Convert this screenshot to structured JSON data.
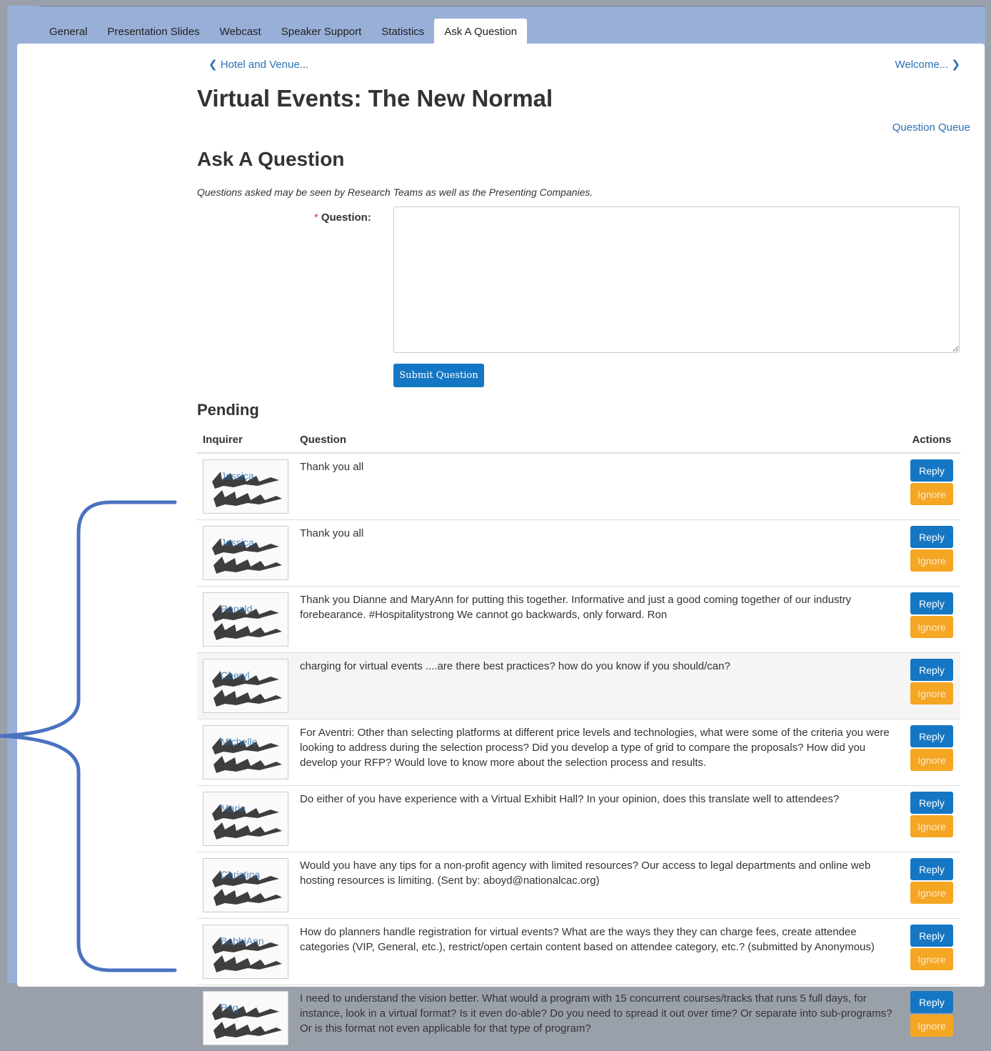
{
  "tabs": [
    "General",
    "Presentation Slides",
    "Webcast",
    "Speaker Support",
    "Statistics",
    "Ask A Question"
  ],
  "pager": {
    "prev": "Hotel and Venue...",
    "next": "Welcome..."
  },
  "page_title": "Virtual Events: The New Normal",
  "queue_link": "Question Queue",
  "section_title": "Ask A Question",
  "disclaimer": "Questions asked may be seen by Research Teams as well as the Presenting Companies.",
  "form": {
    "required_mark": "*",
    "question_label": "Question:",
    "question_value": "",
    "submit_label": "Submit Question"
  },
  "pending": {
    "title": "Pending",
    "headers": {
      "inquirer": "Inquirer",
      "question": "Question",
      "actions": "Actions"
    },
    "reply_label": "Reply",
    "ignore_label": "Ignore",
    "rows": [
      {
        "name": "Jessica",
        "question": "Thank you all"
      },
      {
        "name": "Jessica",
        "question": "Thank you all"
      },
      {
        "name": "Ronald",
        "question": "Thank you Dianne and MaryAnn for putting this together. Informative and just a good coming together of our industry forebearance. #Hospitalitystrong We cannot go backwards, only forward. Ron"
      },
      {
        "name": "Cheryl",
        "question": "charging for virtual events ....are there best practices? how do you know if you should/can?"
      },
      {
        "name": "Michelle",
        "question": "For Aventri: Other than selecting platforms at different price levels and technologies, what were some of the criteria you were looking to address during the selection process? Did you develop a type of grid to compare the proposals? How did you develop your RFP? Would love to know more about the selection process and results."
      },
      {
        "name": "Marie",
        "question": "Do either of you have experience with a Virtual Exhibit Hall? In your opinion, does this translate well to attendees?"
      },
      {
        "name": "Christina",
        "question": "Would you have any tips for a non-profit agency with limited resources? Our access to legal departments and online web hosting resources is limiting. (Sent by: aboyd@nationalcac.org)"
      },
      {
        "name": "BobbiAnn",
        "question": "How do planners handle registration for virtual events? What are the ways they they can charge fees, create attendee categories (VIP, General, etc.), restrict/open certain content based on attendee category, etc.? (submitted by Anonymous)"
      },
      {
        "name": "Peg",
        "question": "I need to understand the vision better. What would a program with 15 concurrent courses/tracks that runs 5 full days, for instance, look in a virtual format? Is it even do-able? Do you need to spread it out over time? Or separate into sub-programs? Or is this format not even applicable for that type of program?"
      }
    ]
  },
  "colors": {
    "link": "#2a6fb4",
    "primary": "#1577c4",
    "warning": "#f5a623",
    "annotation": "#4a72c0"
  }
}
